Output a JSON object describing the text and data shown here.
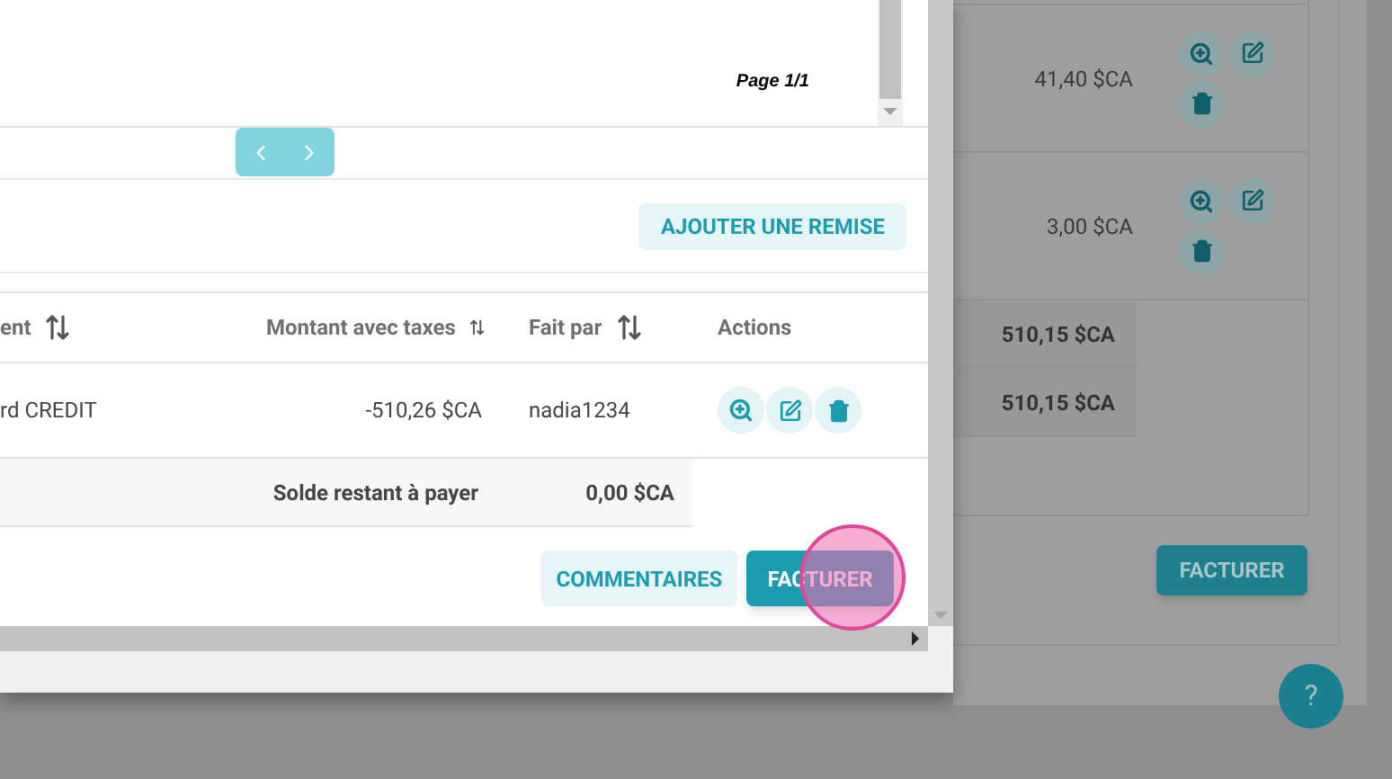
{
  "preview": {
    "page_label": "Page 1/1"
  },
  "discount_button": "AJOUTER UNE REMISE",
  "payments_table": {
    "columns": [
      {
        "label": "ent",
        "sortable": true
      },
      {
        "label": "Montant avec taxes",
        "sortable": true
      },
      {
        "label": "Fait par",
        "sortable": true
      },
      {
        "label": "Actions",
        "sortable": false
      }
    ],
    "rows": [
      {
        "method": "rd CREDIT",
        "amount": "-510,26 $CA",
        "user": "nadia1234"
      }
    ],
    "balance": {
      "label": "Solde restant à payer",
      "value": "0,00 $CA"
    }
  },
  "buttons": [
    {
      "label": "COMMENTAIRES",
      "kind": "secondary"
    },
    {
      "label": "FACTURER",
      "kind": "primary"
    }
  ],
  "background": {
    "rows": [
      {
        "amount": "41,40 $CA"
      },
      {
        "amount": "3,00 $CA"
      }
    ],
    "totals": [
      "510,15 $CA",
      "510,15 $CA"
    ],
    "invoice_button": "FACTURER",
    "help_button": "?"
  }
}
